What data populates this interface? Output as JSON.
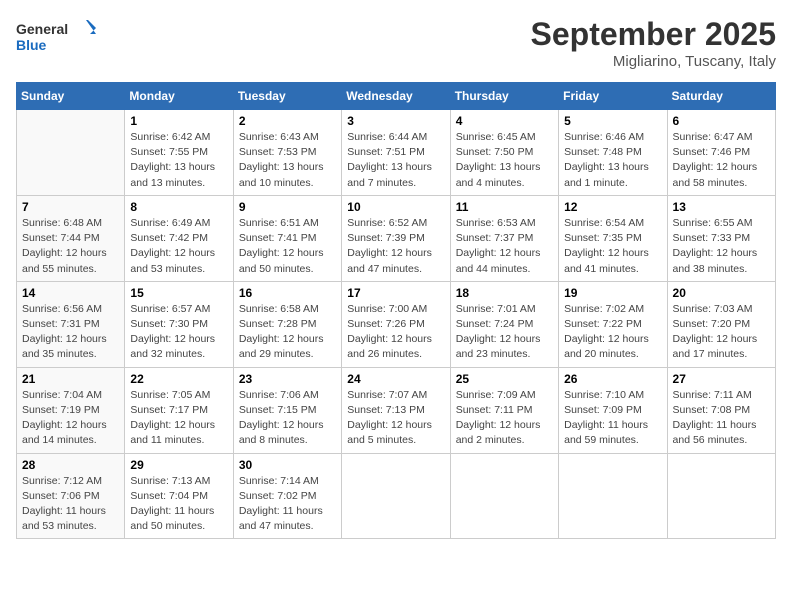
{
  "logo": {
    "line1": "General",
    "line2": "Blue"
  },
  "header": {
    "title": "September 2025",
    "subtitle": "Migliarino, Tuscany, Italy"
  },
  "days_of_week": [
    "Sunday",
    "Monday",
    "Tuesday",
    "Wednesday",
    "Thursday",
    "Friday",
    "Saturday"
  ],
  "weeks": [
    [
      {
        "day": "",
        "info": ""
      },
      {
        "day": "1",
        "info": "Sunrise: 6:42 AM\nSunset: 7:55 PM\nDaylight: 13 hours\nand 13 minutes."
      },
      {
        "day": "2",
        "info": "Sunrise: 6:43 AM\nSunset: 7:53 PM\nDaylight: 13 hours\nand 10 minutes."
      },
      {
        "day": "3",
        "info": "Sunrise: 6:44 AM\nSunset: 7:51 PM\nDaylight: 13 hours\nand 7 minutes."
      },
      {
        "day": "4",
        "info": "Sunrise: 6:45 AM\nSunset: 7:50 PM\nDaylight: 13 hours\nand 4 minutes."
      },
      {
        "day": "5",
        "info": "Sunrise: 6:46 AM\nSunset: 7:48 PM\nDaylight: 13 hours\nand 1 minute."
      },
      {
        "day": "6",
        "info": "Sunrise: 6:47 AM\nSunset: 7:46 PM\nDaylight: 12 hours\nand 58 minutes."
      }
    ],
    [
      {
        "day": "7",
        "info": "Sunrise: 6:48 AM\nSunset: 7:44 PM\nDaylight: 12 hours\nand 55 minutes."
      },
      {
        "day": "8",
        "info": "Sunrise: 6:49 AM\nSunset: 7:42 PM\nDaylight: 12 hours\nand 53 minutes."
      },
      {
        "day": "9",
        "info": "Sunrise: 6:51 AM\nSunset: 7:41 PM\nDaylight: 12 hours\nand 50 minutes."
      },
      {
        "day": "10",
        "info": "Sunrise: 6:52 AM\nSunset: 7:39 PM\nDaylight: 12 hours\nand 47 minutes."
      },
      {
        "day": "11",
        "info": "Sunrise: 6:53 AM\nSunset: 7:37 PM\nDaylight: 12 hours\nand 44 minutes."
      },
      {
        "day": "12",
        "info": "Sunrise: 6:54 AM\nSunset: 7:35 PM\nDaylight: 12 hours\nand 41 minutes."
      },
      {
        "day": "13",
        "info": "Sunrise: 6:55 AM\nSunset: 7:33 PM\nDaylight: 12 hours\nand 38 minutes."
      }
    ],
    [
      {
        "day": "14",
        "info": "Sunrise: 6:56 AM\nSunset: 7:31 PM\nDaylight: 12 hours\nand 35 minutes."
      },
      {
        "day": "15",
        "info": "Sunrise: 6:57 AM\nSunset: 7:30 PM\nDaylight: 12 hours\nand 32 minutes."
      },
      {
        "day": "16",
        "info": "Sunrise: 6:58 AM\nSunset: 7:28 PM\nDaylight: 12 hours\nand 29 minutes."
      },
      {
        "day": "17",
        "info": "Sunrise: 7:00 AM\nSunset: 7:26 PM\nDaylight: 12 hours\nand 26 minutes."
      },
      {
        "day": "18",
        "info": "Sunrise: 7:01 AM\nSunset: 7:24 PM\nDaylight: 12 hours\nand 23 minutes."
      },
      {
        "day": "19",
        "info": "Sunrise: 7:02 AM\nSunset: 7:22 PM\nDaylight: 12 hours\nand 20 minutes."
      },
      {
        "day": "20",
        "info": "Sunrise: 7:03 AM\nSunset: 7:20 PM\nDaylight: 12 hours\nand 17 minutes."
      }
    ],
    [
      {
        "day": "21",
        "info": "Sunrise: 7:04 AM\nSunset: 7:19 PM\nDaylight: 12 hours\nand 14 minutes."
      },
      {
        "day": "22",
        "info": "Sunrise: 7:05 AM\nSunset: 7:17 PM\nDaylight: 12 hours\nand 11 minutes."
      },
      {
        "day": "23",
        "info": "Sunrise: 7:06 AM\nSunset: 7:15 PM\nDaylight: 12 hours\nand 8 minutes."
      },
      {
        "day": "24",
        "info": "Sunrise: 7:07 AM\nSunset: 7:13 PM\nDaylight: 12 hours\nand 5 minutes."
      },
      {
        "day": "25",
        "info": "Sunrise: 7:09 AM\nSunset: 7:11 PM\nDaylight: 12 hours\nand 2 minutes."
      },
      {
        "day": "26",
        "info": "Sunrise: 7:10 AM\nSunset: 7:09 PM\nDaylight: 11 hours\nand 59 minutes."
      },
      {
        "day": "27",
        "info": "Sunrise: 7:11 AM\nSunset: 7:08 PM\nDaylight: 11 hours\nand 56 minutes."
      }
    ],
    [
      {
        "day": "28",
        "info": "Sunrise: 7:12 AM\nSunset: 7:06 PM\nDaylight: 11 hours\nand 53 minutes."
      },
      {
        "day": "29",
        "info": "Sunrise: 7:13 AM\nSunset: 7:04 PM\nDaylight: 11 hours\nand 50 minutes."
      },
      {
        "day": "30",
        "info": "Sunrise: 7:14 AM\nSunset: 7:02 PM\nDaylight: 11 hours\nand 47 minutes."
      },
      {
        "day": "",
        "info": ""
      },
      {
        "day": "",
        "info": ""
      },
      {
        "day": "",
        "info": ""
      },
      {
        "day": "",
        "info": ""
      }
    ]
  ]
}
